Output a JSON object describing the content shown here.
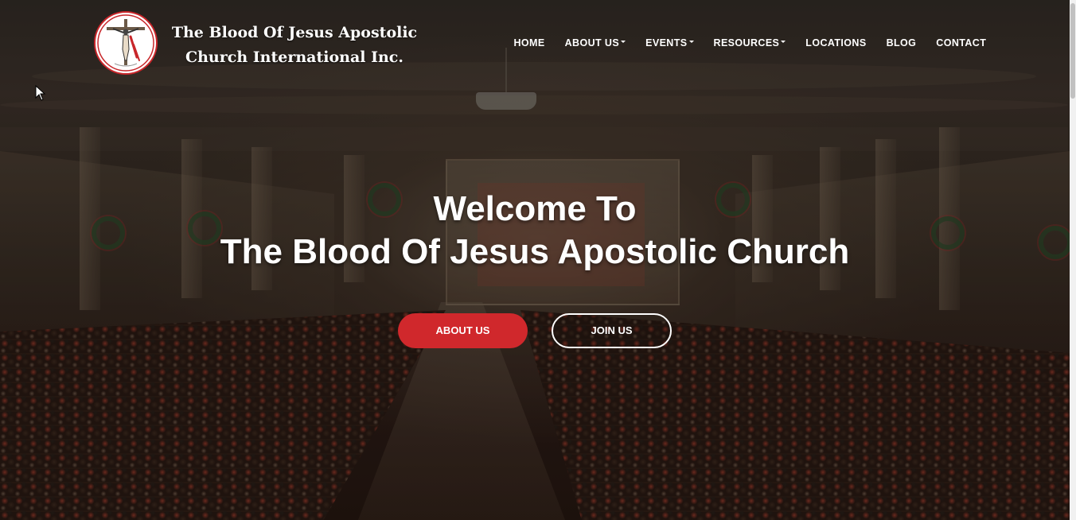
{
  "brand": {
    "line1": "The Blood Of Jesus Apostolic",
    "line2": "Church International Inc."
  },
  "nav": {
    "items": [
      {
        "label": "HOME",
        "dropdown": false
      },
      {
        "label": "ABOUT US",
        "dropdown": true
      },
      {
        "label": "EVENTS",
        "dropdown": true
      },
      {
        "label": "RESOURCES",
        "dropdown": true
      },
      {
        "label": "LOCATIONS",
        "dropdown": false
      },
      {
        "label": "BLOG",
        "dropdown": false
      },
      {
        "label": "CONTACT",
        "dropdown": false
      }
    ]
  },
  "hero": {
    "title_line1": "Welcome To",
    "title_line2": "The Blood Of Jesus Apostolic Church",
    "about_button": "ABOUT US",
    "join_button": "JOIN US"
  },
  "colors": {
    "accent_red": "#d0282c",
    "text": "#ffffff"
  }
}
